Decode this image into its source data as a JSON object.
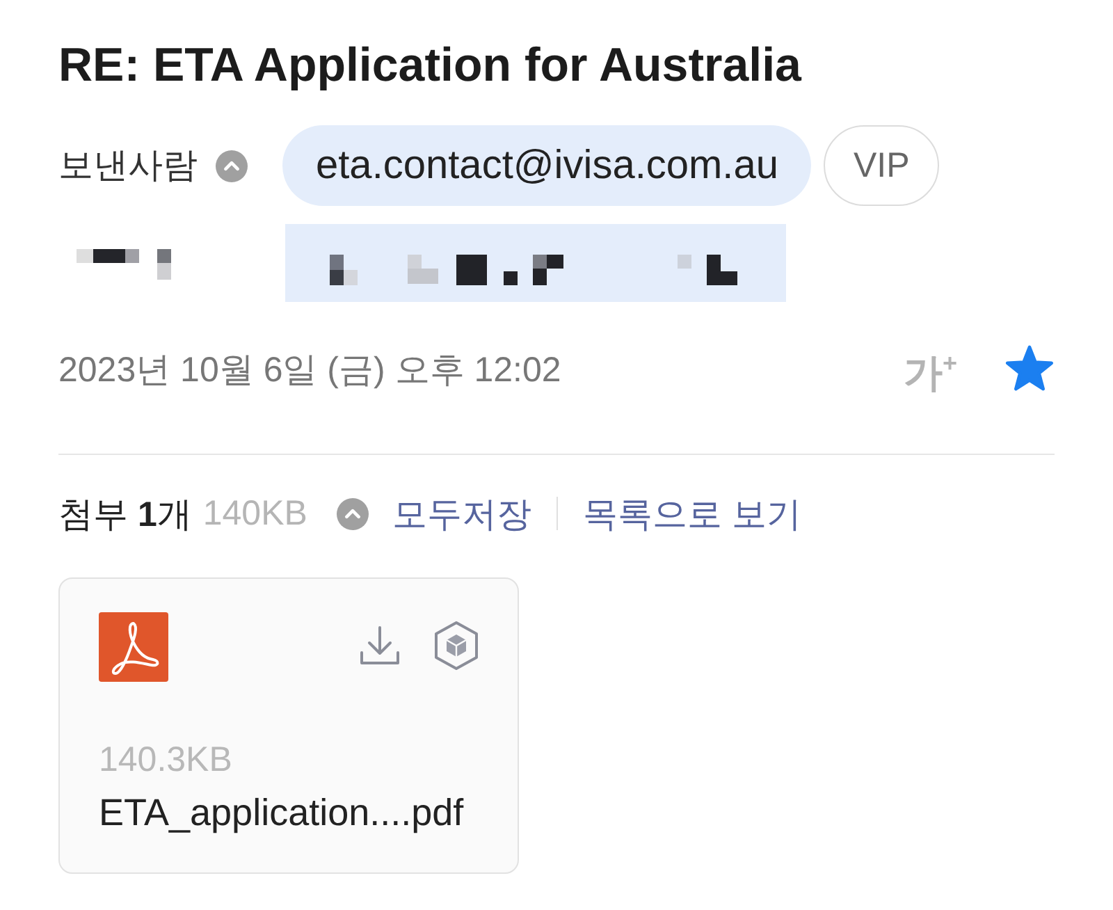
{
  "header": {
    "title": "RE: ETA Application for Australia"
  },
  "sender": {
    "label": "보낸사람",
    "expanded": true,
    "address": "eta.contact@ivisa.com.au",
    "badge": "VIP"
  },
  "meta": {
    "date": "2023년 10월 6일 (금) 오후 12:02",
    "text_size_button": "가$^{+}$",
    "starred": true
  },
  "attachments": {
    "count_label": "첨부 **1**개",
    "total_size": "140KB",
    "expanded": true,
    "actions": [
      "모두저장",
      "목록으로 보기"
    ],
    "files": [
      {
        "kind": "pdf",
        "size": "140.3KB",
        "name": "ETA_application....pdf"
      }
    ]
  }
}
